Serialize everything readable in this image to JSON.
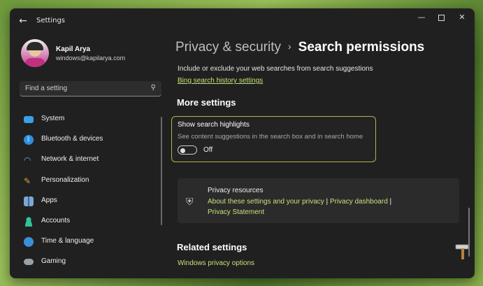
{
  "window": {
    "title": "Settings"
  },
  "user": {
    "name": "Kapil Arya",
    "email": "windows@kapilarya.com"
  },
  "search": {
    "placeholder": "Find a setting"
  },
  "sidebar": {
    "items": [
      {
        "label": "System",
        "icon": "monitor-icon",
        "color": "#3aa0e8"
      },
      {
        "label": "Bluetooth & devices",
        "icon": "bluetooth-icon",
        "color": "#2f8fe0"
      },
      {
        "label": "Network & internet",
        "icon": "wifi-icon",
        "color": "#5ab4f0"
      },
      {
        "label": "Personalization",
        "icon": "brush-icon",
        "color": "#e89a3a"
      },
      {
        "label": "Apps",
        "icon": "apps-icon",
        "color": "#7aa8d8"
      },
      {
        "label": "Accounts",
        "icon": "person-icon",
        "color": "#2fc49a"
      },
      {
        "label": "Time & language",
        "icon": "globe-clock-icon",
        "color": "#3a8fd8"
      },
      {
        "label": "Gaming",
        "icon": "controller-icon",
        "color": "#9aa0a8"
      }
    ]
  },
  "breadcrumb": {
    "parent": "Privacy & security",
    "separator": "›",
    "current": "Search permissions"
  },
  "main": {
    "description": "Include or exclude your web searches from search suggestions",
    "bing_link": "Bing search history settings",
    "more_settings_heading": "More settings",
    "highlights": {
      "title": "Show search highlights",
      "subtitle": "See content suggestions in the search box and in search home",
      "toggle_state": "Off"
    },
    "privacy_resources": {
      "title": "Privacy resources",
      "link1": "About these settings and your privacy",
      "link2": "Privacy dashboard",
      "link3": "Privacy Statement",
      "divider": "|"
    },
    "related_heading": "Related settings",
    "related_link": "Windows privacy options"
  },
  "colors": {
    "accent_link": "#c6e27a",
    "window_bg": "#202020",
    "highlight_border": "#b9b14a"
  }
}
